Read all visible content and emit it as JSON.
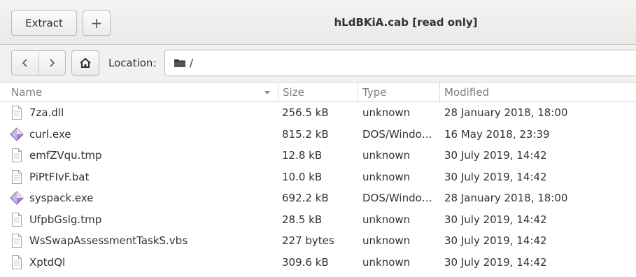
{
  "header": {
    "extract_label": "Extract",
    "plus_label": "+",
    "title": "hLdBKiA.cab [read only]"
  },
  "toolbar": {
    "back_icon": "chevron-left-icon",
    "forward_icon": "chevron-right-icon",
    "home_icon": "home-icon",
    "location_label": "Location:",
    "location_path": "/",
    "folder_icon": "folder-icon"
  },
  "columns": {
    "name": "Name",
    "size": "Size",
    "type": "Type",
    "modified": "Modified"
  },
  "files": [
    {
      "name": "7za.dll",
      "size": "256.5 kB",
      "type": "unknown",
      "modified": "28 January 2018, 18:00",
      "icon": "text-file-icon"
    },
    {
      "name": "curl.exe",
      "size": "815.2 kB",
      "type": "DOS/Windo…",
      "modified": "16 May 2018, 23:39",
      "icon": "executable-icon"
    },
    {
      "name": "emfZVqu.tmp",
      "size": "12.8 kB",
      "type": "unknown",
      "modified": "30 July 2019, 14:42",
      "icon": "text-file-icon"
    },
    {
      "name": "PiPtFIvF.bat",
      "size": "10.0 kB",
      "type": "unknown",
      "modified": "30 July 2019, 14:42",
      "icon": "text-file-icon"
    },
    {
      "name": "syspack.exe",
      "size": "692.2 kB",
      "type": "DOS/Windo…",
      "modified": "28 January 2018, 18:00",
      "icon": "executable-icon"
    },
    {
      "name": "UfpbGslg.tmp",
      "size": "28.5 kB",
      "type": "unknown",
      "modified": "30 July 2019, 14:42",
      "icon": "text-file-icon"
    },
    {
      "name": "WsSwapAssessmentTaskS.vbs",
      "size": "227 bytes",
      "type": "unknown",
      "modified": "30 July 2019, 14:42",
      "icon": "text-file-icon"
    },
    {
      "name": "XptdQl",
      "size": "309.6 kB",
      "type": "unknown",
      "modified": "30 July 2019, 14:42",
      "icon": "text-file-icon"
    }
  ],
  "colors": {
    "header_text": "#7c7f7a",
    "text": "#2e3436",
    "exe_icon_light": "#c9b6e6",
    "exe_icon_dark": "#7a5aa8"
  }
}
